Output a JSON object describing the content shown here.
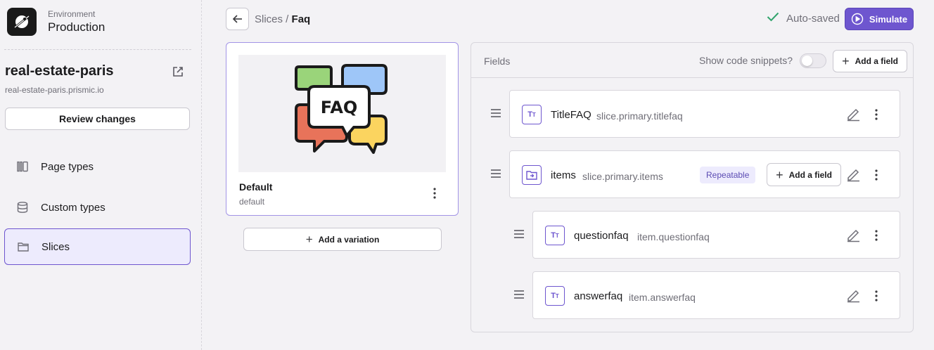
{
  "sidebar": {
    "environment_label": "Environment",
    "environment_name": "Production",
    "repo_name": "real-estate-paris",
    "repo_url": "real-estate-paris.prismic.io",
    "review_label": "Review changes",
    "nav": [
      {
        "label": "Page types",
        "icon": "page-types-icon"
      },
      {
        "label": "Custom types",
        "icon": "database-icon"
      },
      {
        "label": "Slices",
        "icon": "folder-icon",
        "active": true
      }
    ]
  },
  "header": {
    "breadcrumb_parent": "Slices",
    "breadcrumb_sep": " / ",
    "breadcrumb_current": "Faq",
    "autosaved": "Auto-saved",
    "simulate": "Simulate"
  },
  "variation": {
    "thumb_text": "FAQ",
    "name": "Default",
    "id": "default",
    "add_label": "Add a variation"
  },
  "fields": {
    "title": "Fields",
    "snippets_label": "Show code snippets?",
    "snippets_enabled": false,
    "add_label": "Add a field",
    "rows": [
      {
        "icon": "Tt",
        "name": "TitleFAQ",
        "path": "slice.primary.titlefaq"
      },
      {
        "icon": "group",
        "name": "items",
        "path": "slice.primary.items",
        "badge": "Repeatable",
        "add_label": "Add a field"
      },
      {
        "icon": "Tt",
        "name": "questionfaq",
        "path": "item.questionfaq"
      },
      {
        "icon": "Tt",
        "name": "answerfaq",
        "path": "item.answerfaq"
      }
    ]
  },
  "colors": {
    "accent": "#6e56cf",
    "accent_light": "#edebfd",
    "success": "#30a46c"
  }
}
